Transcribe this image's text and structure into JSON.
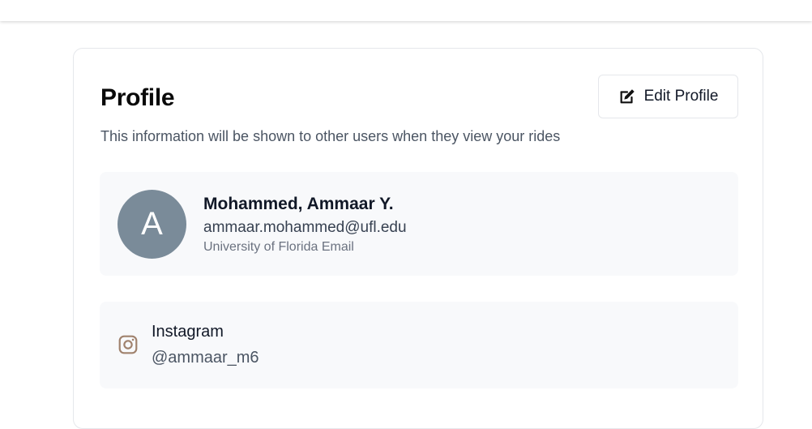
{
  "profile": {
    "title": "Profile",
    "subtitle": "This information will be shown to other users when they view your rides",
    "edit_button_label": "Edit Profile",
    "edit_icon": "edit-icon"
  },
  "user": {
    "avatar_initial": "A",
    "avatar_color": "#7a8b99",
    "name": "Mohammed, Ammaar Y.",
    "email": "ammaar.mohammed@ufl.edu",
    "email_label": "University of Florida Email"
  },
  "social": {
    "icon": "instagram-icon",
    "icon_color": "#a0826d",
    "platform": "Instagram",
    "handle": "@ammaar_m6"
  },
  "colors": {
    "panel_background": "#f8f9fb",
    "card_border": "#e5e7eb"
  }
}
